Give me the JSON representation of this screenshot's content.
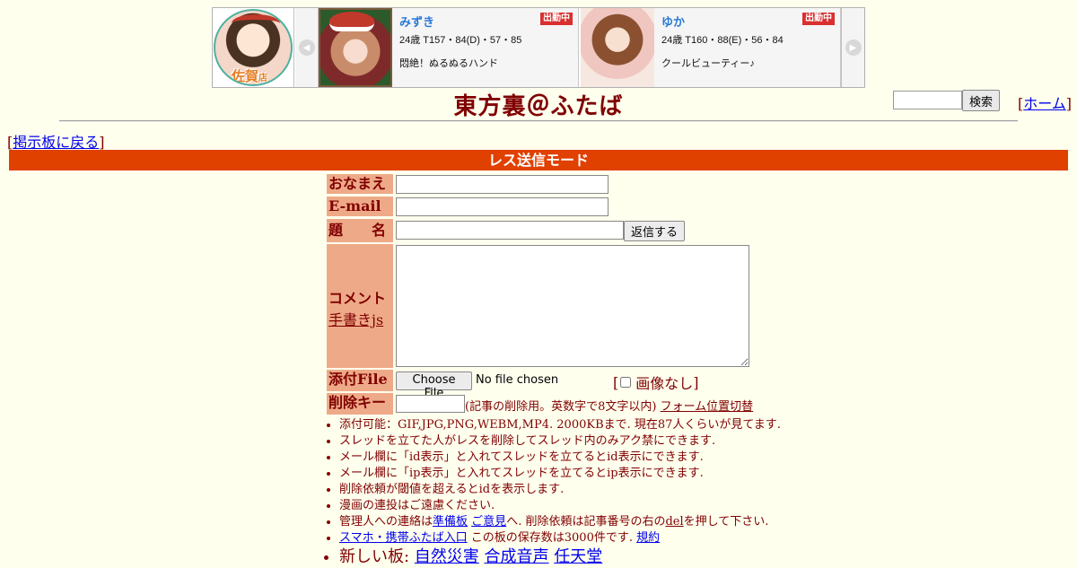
{
  "banner": {
    "shop_logo": {
      "text": "佐賀",
      "sub": "店"
    },
    "cards": [
      {
        "name": "みずき",
        "badge": "出勤中",
        "stats": "24歳 T157・84(D)・57・85",
        "catch": "悶絶！ぬるぬるハンド"
      },
      {
        "name": "ゆか",
        "badge": "出勤中",
        "stats": "24歳 T160・88(E)・56・84",
        "catch": "クールビューティー♪"
      }
    ]
  },
  "header": {
    "title": "東方裏＠ふたば",
    "search_button": "検索",
    "home_prefix": "[",
    "home_label": "ホーム",
    "home_suffix": "]"
  },
  "nav": {
    "back_prefix": "[",
    "back_label": "掲示板に戻る",
    "back_suffix": "]"
  },
  "mode_bar": "レス送信モード",
  "form": {
    "name_label": "おなまえ",
    "email_label": "E-mail",
    "subject_label": "題　　名",
    "reply_button": "返信する",
    "comment_label": "コメント",
    "handwrite_link": "手書きjs",
    "file_label": "添付File",
    "file_button": "Choose File",
    "file_status": "No file chosen",
    "noimage_prefix": "[",
    "noimage_label": "画像なし",
    "noimage_suffix": "]",
    "delkey_label": "削除キー",
    "delkey_note": "(記事の削除用。英数字で8文字以内)",
    "form_position_link": "フォーム位置切替"
  },
  "notes": {
    "n1": "添付可能：GIF,JPG,PNG,WEBM,MP4. 2000KBまで. 現在87人くらいが見てます.",
    "n2": "スレッドを立てた人がレスを削除してスレッド内のみアク禁にできます.",
    "n3": "メール欄に「id表示」と入れてスレッドを立てるとid表示にできます.",
    "n4": "メール欄に「ip表示」と入れてスレッドを立てるとip表示にできます.",
    "n5": "削除依頼が閾値を超えるとidを表示します.",
    "n6": "漫画の連投はご遠慮ください.",
    "n7_a": "管理人への連絡は",
    "n7_link1": "準備板",
    "n7_link2": "ご意見",
    "n7_b": "へ. 削除依頼は記事番号の右の",
    "n7_del": "del",
    "n7_c": "を押して下さい.",
    "n8_link": "スマホ・携帯ふたば入口",
    "n8_text": " この板の保存数は3000件です.",
    "n8_rules": "規約",
    "n9_prefix": "新しい板: ",
    "n9_boards": [
      "自然災害",
      "合成音声",
      "任天堂"
    ]
  }
}
